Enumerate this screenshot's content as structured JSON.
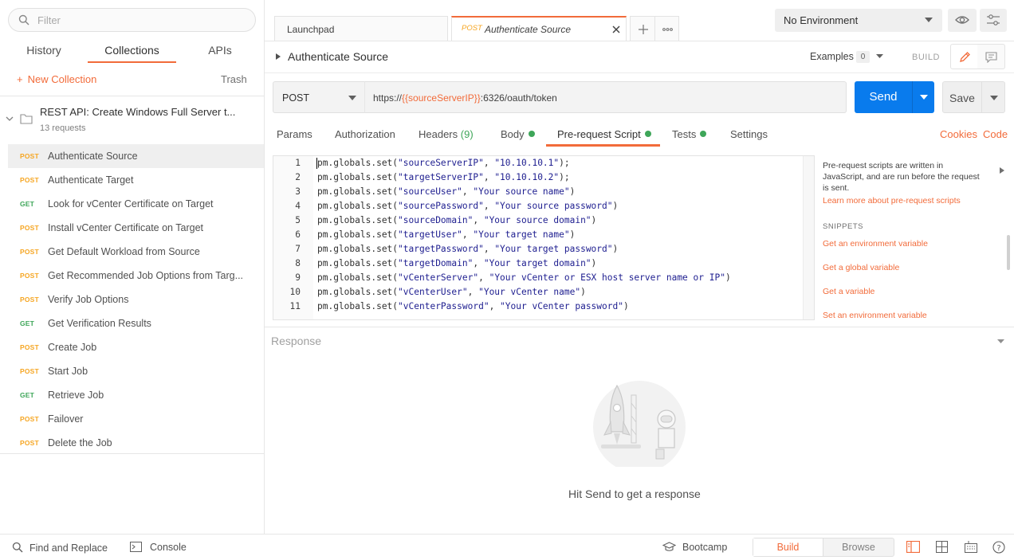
{
  "sidebar": {
    "filter_placeholder": "Filter",
    "tabs": [
      {
        "label": "History"
      },
      {
        "label": "Collections"
      },
      {
        "label": "APIs"
      }
    ],
    "new_collection": "New Collection",
    "trash": "Trash",
    "collection": {
      "name": "REST API: Create Windows Full Server t...",
      "count": "13 requests"
    },
    "requests": [
      {
        "method": "POST",
        "name": "Authenticate Source"
      },
      {
        "method": "POST",
        "name": "Authenticate Target"
      },
      {
        "method": "GET",
        "name": "Look for vCenter Certificate on Target"
      },
      {
        "method": "POST",
        "name": "Install vCenter Certificate on Target"
      },
      {
        "method": "POST",
        "name": "Get Default Workload from Source"
      },
      {
        "method": "POST",
        "name": "Get Recommended Job Options from Targ..."
      },
      {
        "method": "POST",
        "name": "Verify Job Options"
      },
      {
        "method": "GET",
        "name": "Get Verification Results"
      },
      {
        "method": "POST",
        "name": "Create Job"
      },
      {
        "method": "POST",
        "name": "Start Job"
      },
      {
        "method": "GET",
        "name": "Retrieve Job"
      },
      {
        "method": "POST",
        "name": "Failover"
      },
      {
        "method": "POST",
        "name": "Delete the Job"
      }
    ]
  },
  "tabs": {
    "launchpad": "Launchpad",
    "active_method": "POST",
    "active_name": "Authenticate Source"
  },
  "environment": {
    "selected": "No Environment"
  },
  "request": {
    "title": "Authenticate Source",
    "examples_label": "Examples",
    "examples_count": "0",
    "build_label": "BUILD",
    "method": "POST",
    "url_prefix": "https://",
    "url_var": "{{sourceServerIP}}",
    "url_suffix": ":6326/oauth/token",
    "send": "Send",
    "save": "Save"
  },
  "request_tabs": {
    "params": "Params",
    "authorization": "Authorization",
    "headers": "Headers",
    "headers_count": "(9)",
    "body": "Body",
    "prerequest": "Pre-request Script",
    "tests": "Tests",
    "settings": "Settings",
    "cookies": "Cookies",
    "code": "Code"
  },
  "script_lines": [
    {
      "n": "1",
      "key": "\"sourceServerIP\"",
      "val": "\"10.10.10.1\"",
      "end": ");"
    },
    {
      "n": "2",
      "key": "\"targetServerIP\"",
      "val": "\"10.10.10.2\"",
      "end": ");"
    },
    {
      "n": "3",
      "key": "\"sourceUser\"",
      "val": "\"Your source name\"",
      "end": ")"
    },
    {
      "n": "4",
      "key": "\"sourcePassword\"",
      "val": "\"Your source password\"",
      "end": ")"
    },
    {
      "n": "5",
      "key": "\"sourceDomain\"",
      "val": "\"Your source domain\"",
      "end": ")"
    },
    {
      "n": "6",
      "key": "\"targetUser\"",
      "val": "\"Your target name\"",
      "end": ")"
    },
    {
      "n": "7",
      "key": "\"targetPassword\"",
      "val": "\"Your target password\"",
      "end": ")"
    },
    {
      "n": "8",
      "key": "\"targetDomain\"",
      "val": "\"Your target domain\"",
      "end": ")"
    },
    {
      "n": "9",
      "key": "\"vCenterServer\"",
      "val": "\"Your vCenter or ESX host server name or IP\"",
      "end": ")"
    },
    {
      "n": "10",
      "key": "\"vCenterUser\"",
      "val": "\"Your vCenter name\"",
      "end": ")"
    },
    {
      "n": "11",
      "key": "\"vCenterPassword\"",
      "val": "\"Your vCenter password\"",
      "end": ")"
    }
  ],
  "script_prefix": "pm.globals.set(",
  "snippets": {
    "description": "Pre-request scripts are written in JavaScript, and are run before the request is sent.",
    "learn_more": "Learn more about pre-request scripts",
    "heading": "SNIPPETS",
    "items": [
      "Get an environment variable",
      "Get a global variable",
      "Get a variable",
      "Set an environment variable"
    ]
  },
  "response": {
    "title": "Response",
    "empty_message": "Hit Send to get a response"
  },
  "statusbar": {
    "find_replace": "Find and Replace",
    "console": "Console",
    "bootcamp": "Bootcamp",
    "build": "Build",
    "browse": "Browse"
  },
  "colors": {
    "accent": "#f26b3a",
    "send_blue": "#097bed",
    "post": "#f6a623",
    "get": "#3ea659"
  }
}
